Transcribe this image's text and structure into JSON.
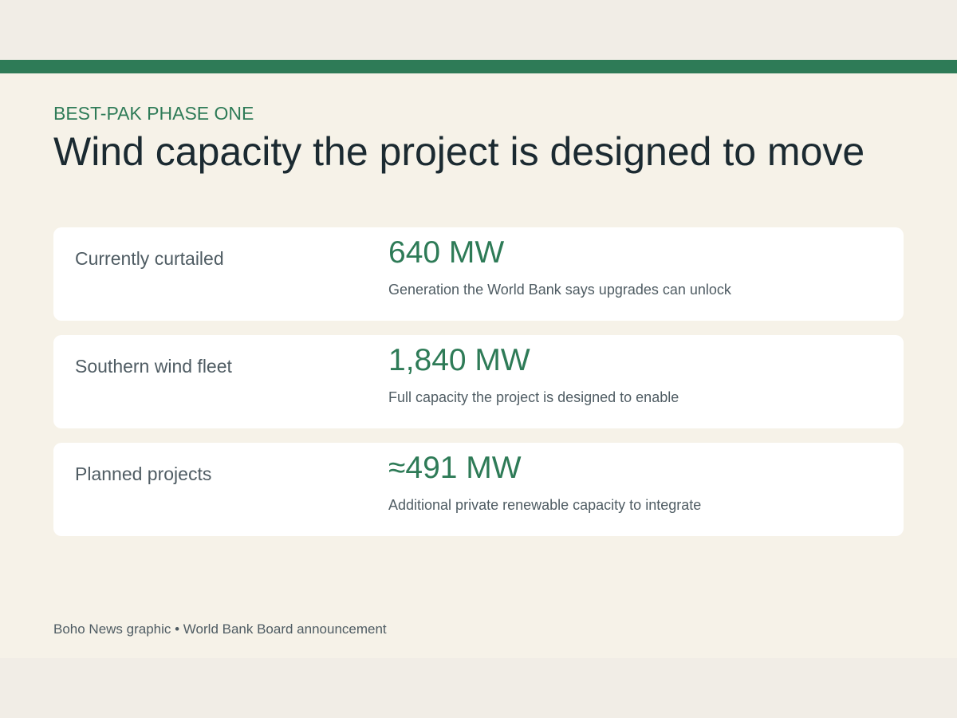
{
  "kicker": "BEST-PAK PHASE ONE",
  "headline": "Wind capacity the project is designed to move",
  "cards": [
    {
      "label": "Currently curtailed",
      "value": "640 MW",
      "description": "Generation the World Bank says upgrades can unlock"
    },
    {
      "label": "Southern wind fleet",
      "value": "1,840 MW",
      "description": "Full capacity the project is designed to enable"
    },
    {
      "label": "Planned projects",
      "value": "≈491 MW",
      "description": "Additional private renewable capacity to integrate"
    }
  ],
  "footer": "Boho News graphic • World Bank Board announcement",
  "colors": {
    "accent": "#2e7b57",
    "headline": "#1b2a31",
    "muted_text": "#4f5c63",
    "panel_background": "#f6f2e8",
    "outer_background": "#f1ede6",
    "card_background": "#ffffff"
  }
}
